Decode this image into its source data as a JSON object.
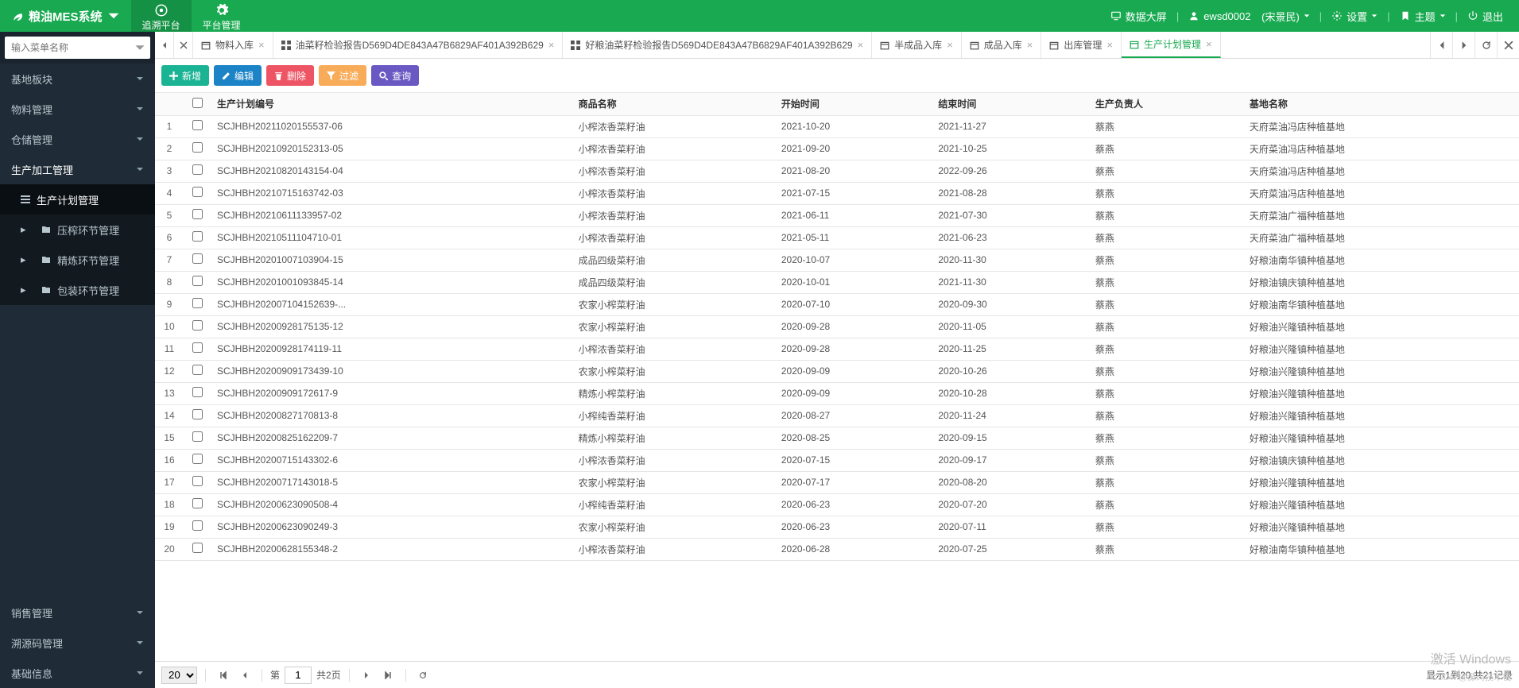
{
  "app": {
    "title": "粮油MES系统"
  },
  "topnav": [
    {
      "label": "追溯平台",
      "active": true
    },
    {
      "label": "平台管理",
      "active": false
    }
  ],
  "headRight": {
    "dashboard": "数据大屏",
    "user": "ewsd0002",
    "realname": "(宋景民)",
    "settings": "设置",
    "theme": "主题",
    "logout": "退出"
  },
  "search": {
    "placeholder": "输入菜单名称"
  },
  "sidebar": {
    "top": [
      {
        "label": "基地板块",
        "expand": false
      },
      {
        "label": "物料管理",
        "expand": false
      },
      {
        "label": "仓储管理",
        "expand": false
      }
    ],
    "prod": {
      "label": "生产加工管理",
      "children": [
        {
          "label": "生产计划管理",
          "active": true,
          "icon": "list"
        },
        {
          "label": "压榨环节管理",
          "icon": "folder"
        },
        {
          "label": "精炼环节管理",
          "icon": "folder"
        },
        {
          "label": "包装环节管理",
          "icon": "folder"
        }
      ]
    },
    "bottom": [
      {
        "label": "销售管理"
      },
      {
        "label": "溯源码管理"
      },
      {
        "label": "基础信息"
      }
    ]
  },
  "tabs": [
    {
      "label": "物料入库",
      "icon": "box",
      "closable": true
    },
    {
      "label": "油菜籽检验报告D569D4DE843A47B6829AF401A392B629",
      "icon": "grid",
      "closable": true
    },
    {
      "label": "好粮油菜籽检验报告D569D4DE843A47B6829AF401A392B629",
      "icon": "grid",
      "closable": true
    },
    {
      "label": "半成品入库",
      "icon": "box",
      "closable": true
    },
    {
      "label": "成品入库",
      "icon": "box",
      "closable": true
    },
    {
      "label": "出库管理",
      "icon": "box",
      "closable": true
    },
    {
      "label": "生产计划管理",
      "icon": "box",
      "closable": true,
      "active": true
    }
  ],
  "toolbar": {
    "add": "新增",
    "edit": "编辑",
    "del": "删除",
    "filter": "过滤",
    "query": "查询"
  },
  "columns": {
    "plan": "生产计划编号",
    "product": "商品名称",
    "start": "开始时间",
    "end": "结束时间",
    "person": "生产负责人",
    "base": "基地名称"
  },
  "rows": [
    {
      "n": 1,
      "plan": "SCJHBH20211020155537-06",
      "product": "小榨浓香菜籽油",
      "start": "2021-10-20",
      "end": "2021-11-27",
      "person": "蔡燕",
      "base": "天府菜油冯店种植基地"
    },
    {
      "n": 2,
      "plan": "SCJHBH20210920152313-05",
      "product": "小榨浓香菜籽油",
      "start": "2021-09-20",
      "end": "2021-10-25",
      "person": "蔡燕",
      "base": "天府菜油冯店种植基地"
    },
    {
      "n": 3,
      "plan": "SCJHBH20210820143154-04",
      "product": "小榨浓香菜籽油",
      "start": "2021-08-20",
      "end": "2022-09-26",
      "person": "蔡燕",
      "base": "天府菜油冯店种植基地"
    },
    {
      "n": 4,
      "plan": "SCJHBH20210715163742-03",
      "product": "小榨浓香菜籽油",
      "start": "2021-07-15",
      "end": "2021-08-28",
      "person": "蔡燕",
      "base": "天府菜油冯店种植基地"
    },
    {
      "n": 5,
      "plan": "SCJHBH20210611133957-02",
      "product": "小榨浓香菜籽油",
      "start": "2021-06-11",
      "end": "2021-07-30",
      "person": "蔡燕",
      "base": "天府菜油广福种植基地"
    },
    {
      "n": 6,
      "plan": "SCJHBH20210511104710-01",
      "product": "小榨浓香菜籽油",
      "start": "2021-05-11",
      "end": "2021-06-23",
      "person": "蔡燕",
      "base": "天府菜油广福种植基地"
    },
    {
      "n": 7,
      "plan": "SCJHBH20201007103904-15",
      "product": "成品四级菜籽油",
      "start": "2020-10-07",
      "end": "2020-11-30",
      "person": "蔡燕",
      "base": "好粮油南华镇种植基地"
    },
    {
      "n": 8,
      "plan": "SCJHBH20201001093845-14",
      "product": "成品四级菜籽油",
      "start": "2020-10-01",
      "end": "2021-11-30",
      "person": "蔡燕",
      "base": "好粮油镇庆镇种植基地"
    },
    {
      "n": 9,
      "plan": "SCJHBH20200710415263​9-...",
      "product": "农家小榨菜籽油",
      "start": "2020-07-10",
      "end": "2020-09-30",
      "person": "蔡燕",
      "base": "好粮油南华镇种植基地"
    },
    {
      "n": 10,
      "plan": "SCJHBH20200928175135-12",
      "product": "农家小榨菜籽油",
      "start": "2020-09-28",
      "end": "2020-11-05",
      "person": "蔡燕",
      "base": "好粮油兴隆镇种植基地"
    },
    {
      "n": 11,
      "plan": "SCJHBH20200928174119-11",
      "product": "小榨浓香菜籽油",
      "start": "2020-09-28",
      "end": "2020-11-25",
      "person": "蔡燕",
      "base": "好粮油兴隆镇种植基地"
    },
    {
      "n": 12,
      "plan": "SCJHBH20200909173439-10",
      "product": "农家小榨菜籽油",
      "start": "2020-09-09",
      "end": "2020-10-26",
      "person": "蔡燕",
      "base": "好粮油兴隆镇种植基地"
    },
    {
      "n": 13,
      "plan": "SCJHBH20200909172617-9",
      "product": "精炼小榨菜籽油",
      "start": "2020-09-09",
      "end": "2020-10-28",
      "person": "蔡燕",
      "base": "好粮油兴隆镇种植基地"
    },
    {
      "n": 14,
      "plan": "SCJHBH20200827170813-8",
      "product": "小榨纯香菜籽油",
      "start": "2020-08-27",
      "end": "2020-11-24",
      "person": "蔡燕",
      "base": "好粮油兴隆镇种植基地"
    },
    {
      "n": 15,
      "plan": "SCJHBH20200825162209-7",
      "product": "精炼小榨菜籽油",
      "start": "2020-08-25",
      "end": "2020-09-15",
      "person": "蔡燕",
      "base": "好粮油兴隆镇种植基地"
    },
    {
      "n": 16,
      "plan": "SCJHBH20200715143302-6",
      "product": "小榨浓香菜籽油",
      "start": "2020-07-15",
      "end": "2020-09-17",
      "person": "蔡燕",
      "base": "好粮油镇庆镇种植基地"
    },
    {
      "n": 17,
      "plan": "SCJHBH20200717143018-5",
      "product": "农家小榨菜籽油",
      "start": "2020-07-17",
      "end": "2020-08-20",
      "person": "蔡燕",
      "base": "好粮油兴隆镇种植基地"
    },
    {
      "n": 18,
      "plan": "SCJHBH20200623090508-4",
      "product": "小榨纯香菜籽油",
      "start": "2020-06-23",
      "end": "2020-07-20",
      "person": "蔡燕",
      "base": "好粮油兴隆镇种植基地"
    },
    {
      "n": 19,
      "plan": "SCJHBH20200623090249-3",
      "product": "农家小榨菜籽油",
      "start": "2020-06-23",
      "end": "2020-07-11",
      "person": "蔡燕",
      "base": "好粮油兴隆镇种植基地"
    },
    {
      "n": 20,
      "plan": "SCJHBH20200628155348-2",
      "product": "小榨浓香菜籽油",
      "start": "2020-06-28",
      "end": "2020-07-25",
      "person": "蔡燕",
      "base": "好粮油南华镇种植基地"
    }
  ],
  "pager": {
    "pagesize": "20",
    "pageLabel": "第",
    "page": "1",
    "totalPagesLabel": "共2页",
    "status": "显示1到20,共21记录"
  },
  "watermark": {
    "l1": "激活 Windows",
    "l2": ""
  },
  "csdn": "CSDN @源码技术栈"
}
